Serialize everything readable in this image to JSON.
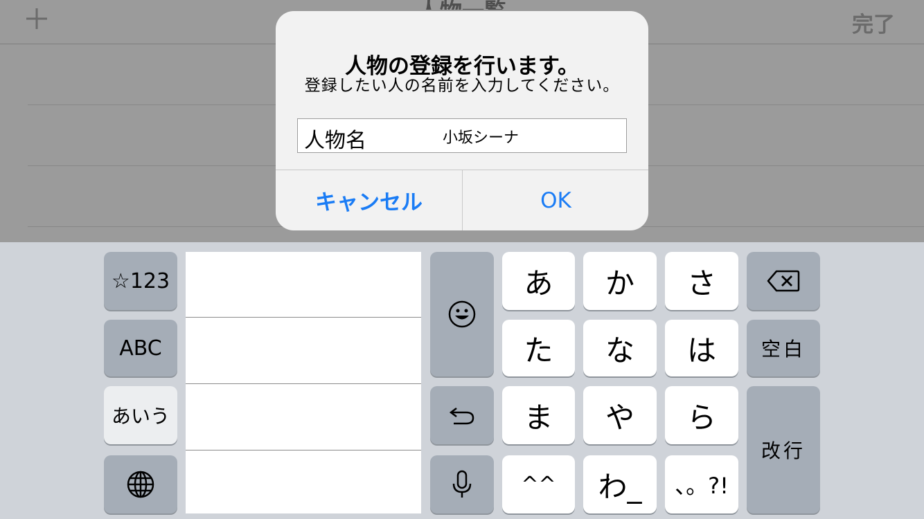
{
  "background_app": {
    "add_icon": "plus-icon",
    "add_label": "+",
    "title": "人物一覧",
    "done_label": "完了"
  },
  "alert": {
    "title": "人物の登録を行います。",
    "message": "登録したい人の名前を入力してください。",
    "field_label": "人物名",
    "field_value": "小坂シーナ",
    "cancel_label": "キャンセル",
    "ok_label": "OK",
    "accent_color": "#1a7cf5"
  },
  "keyboard": {
    "symbols_key": "☆123",
    "abc_key": "ABC",
    "kana_mode_key": "あいう",
    "globe_icon": "globe-icon",
    "emoji_icon": "emoji-icon",
    "undo_icon": "undo-icon",
    "mic_icon": "microphone-icon",
    "delete_icon": "delete-icon",
    "kana_keys": [
      "あ",
      "か",
      "さ",
      "た",
      "な",
      "は",
      "ま",
      "や",
      "ら",
      "^^",
      "わ_",
      "、。?!"
    ],
    "space_key": "空白",
    "return_key": "改行"
  }
}
